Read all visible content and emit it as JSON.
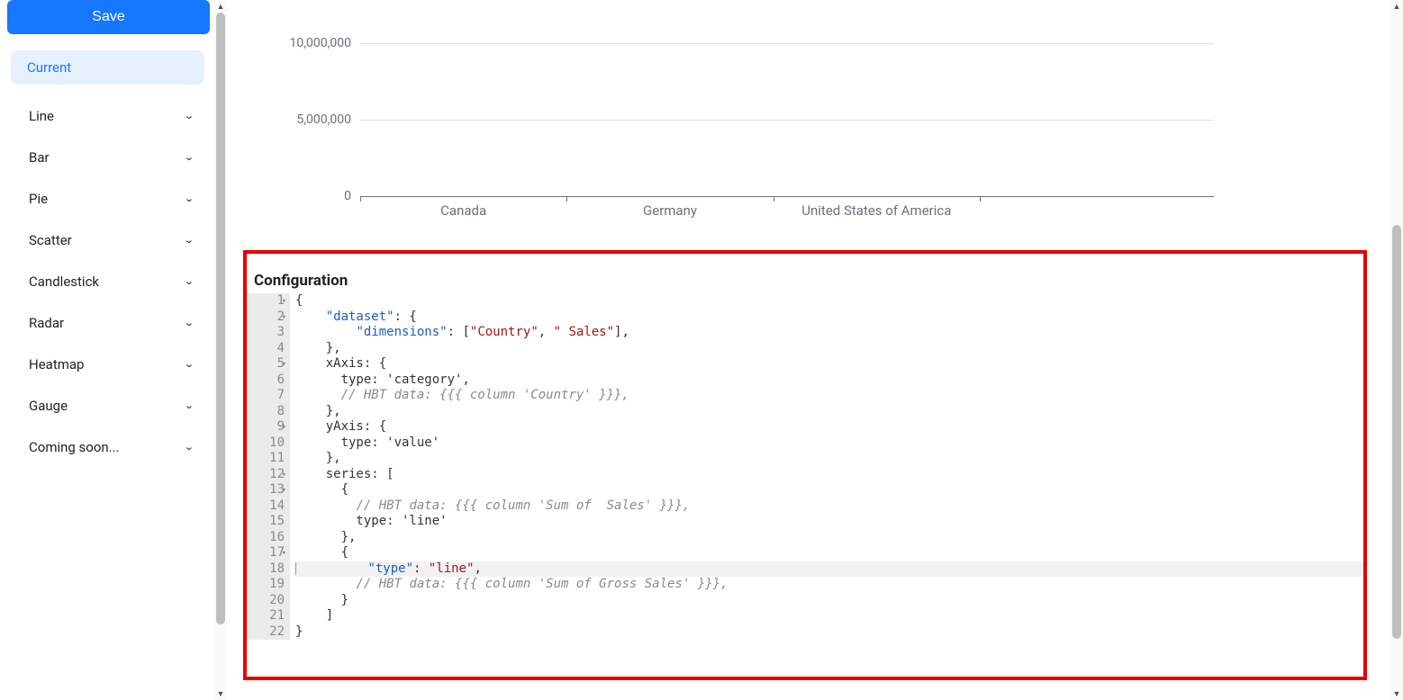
{
  "sidebar": {
    "save": "Save",
    "current": "Current",
    "items": [
      {
        "label": "Line"
      },
      {
        "label": "Bar"
      },
      {
        "label": "Pie"
      },
      {
        "label": "Scatter"
      },
      {
        "label": "Candlestick"
      },
      {
        "label": "Radar"
      },
      {
        "label": "Heatmap"
      },
      {
        "label": "Gauge"
      },
      {
        "label": "Coming soon..."
      }
    ]
  },
  "config": {
    "title": "Configuration",
    "lines": [
      {
        "n": 1,
        "fold": true,
        "cls": "",
        "segs": [
          {
            "t": "{",
            "c": "s-punc"
          }
        ]
      },
      {
        "n": 2,
        "fold": true,
        "cls": "",
        "segs": [
          {
            "t": "    ",
            "c": ""
          },
          {
            "t": "\"dataset\"",
            "c": "s-key"
          },
          {
            "t": ": {",
            "c": "s-punc"
          }
        ]
      },
      {
        "n": 3,
        "fold": false,
        "cls": "",
        "segs": [
          {
            "t": "        ",
            "c": ""
          },
          {
            "t": "\"dimensions\"",
            "c": "s-key"
          },
          {
            "t": ": [",
            "c": "s-punc"
          },
          {
            "t": "\"Country\"",
            "c": "s-str"
          },
          {
            "t": ", ",
            "c": "s-punc"
          },
          {
            "t": "\" Sales\"",
            "c": "s-str"
          },
          {
            "t": "],",
            "c": "s-punc"
          }
        ]
      },
      {
        "n": 4,
        "fold": false,
        "cls": "",
        "segs": [
          {
            "t": "    },",
            "c": "s-punc"
          }
        ]
      },
      {
        "n": 5,
        "fold": true,
        "cls": "",
        "segs": [
          {
            "t": "    xAxis: {",
            "c": "s-punc"
          }
        ]
      },
      {
        "n": 6,
        "fold": false,
        "cls": "",
        "segs": [
          {
            "t": "      type: 'category',",
            "c": "s-punc"
          }
        ]
      },
      {
        "n": 7,
        "fold": false,
        "cls": "",
        "segs": [
          {
            "t": "      ",
            "c": ""
          },
          {
            "t": "// HBT data: {{{ column 'Country' }}},",
            "c": "s-com"
          }
        ]
      },
      {
        "n": 8,
        "fold": false,
        "cls": "",
        "segs": [
          {
            "t": "    },",
            "c": "s-punc"
          }
        ]
      },
      {
        "n": 9,
        "fold": true,
        "cls": "",
        "segs": [
          {
            "t": "    yAxis: {",
            "c": "s-punc"
          }
        ]
      },
      {
        "n": 10,
        "fold": false,
        "cls": "",
        "segs": [
          {
            "t": "      type: 'value'",
            "c": "s-punc"
          }
        ]
      },
      {
        "n": 11,
        "fold": false,
        "cls": "",
        "segs": [
          {
            "t": "    },",
            "c": "s-punc"
          }
        ]
      },
      {
        "n": 12,
        "fold": true,
        "cls": "",
        "segs": [
          {
            "t": "    series: [",
            "c": "s-punc"
          }
        ]
      },
      {
        "n": 13,
        "fold": true,
        "cls": "",
        "segs": [
          {
            "t": "      {",
            "c": "s-punc"
          }
        ]
      },
      {
        "n": 14,
        "fold": false,
        "cls": "",
        "segs": [
          {
            "t": "        ",
            "c": ""
          },
          {
            "t": "// HBT data: {{{ column 'Sum of  Sales' }}},",
            "c": "s-com"
          }
        ]
      },
      {
        "n": 15,
        "fold": false,
        "cls": "",
        "segs": [
          {
            "t": "        type: 'line'",
            "c": "s-punc"
          }
        ]
      },
      {
        "n": 16,
        "fold": false,
        "cls": "",
        "segs": [
          {
            "t": "      },",
            "c": "s-punc"
          }
        ]
      },
      {
        "n": 17,
        "fold": true,
        "cls": "",
        "segs": [
          {
            "t": "      {",
            "c": "s-punc"
          }
        ]
      },
      {
        "n": 18,
        "fold": false,
        "cls": "hl",
        "cursor": true,
        "segs": [
          {
            "t": "        ",
            "c": ""
          },
          {
            "t": "\"type\"",
            "c": "s-key"
          },
          {
            "t": ": ",
            "c": "s-punc"
          },
          {
            "t": "\"line\"",
            "c": "s-str"
          },
          {
            "t": ",",
            "c": "s-punc"
          }
        ]
      },
      {
        "n": 19,
        "fold": false,
        "cls": "",
        "segs": [
          {
            "t": "        ",
            "c": ""
          },
          {
            "t": "// HBT data: {{{ column 'Sum of Gross Sales' }}},",
            "c": "s-com"
          }
        ]
      },
      {
        "n": 20,
        "fold": false,
        "cls": "",
        "segs": [
          {
            "t": "      }",
            "c": "s-punc"
          }
        ]
      },
      {
        "n": 21,
        "fold": false,
        "cls": "",
        "segs": [
          {
            "t": "    ]",
            "c": "s-punc"
          }
        ]
      },
      {
        "n": 22,
        "fold": false,
        "cls": "",
        "segs": [
          {
            "t": "}",
            "c": "s-punc"
          }
        ]
      }
    ]
  },
  "chart_data": {
    "type": "line",
    "categories": [
      "Canada",
      "Germany",
      "United States of America"
    ],
    "series": [],
    "ylim": [
      0,
      10000000
    ],
    "yticks": [
      {
        "v": 0,
        "label": "0"
      },
      {
        "v": 5000000,
        "label": "5,000,000"
      },
      {
        "v": 10000000,
        "label": "10,000,000"
      }
    ],
    "xlabel": "",
    "ylabel": ""
  }
}
